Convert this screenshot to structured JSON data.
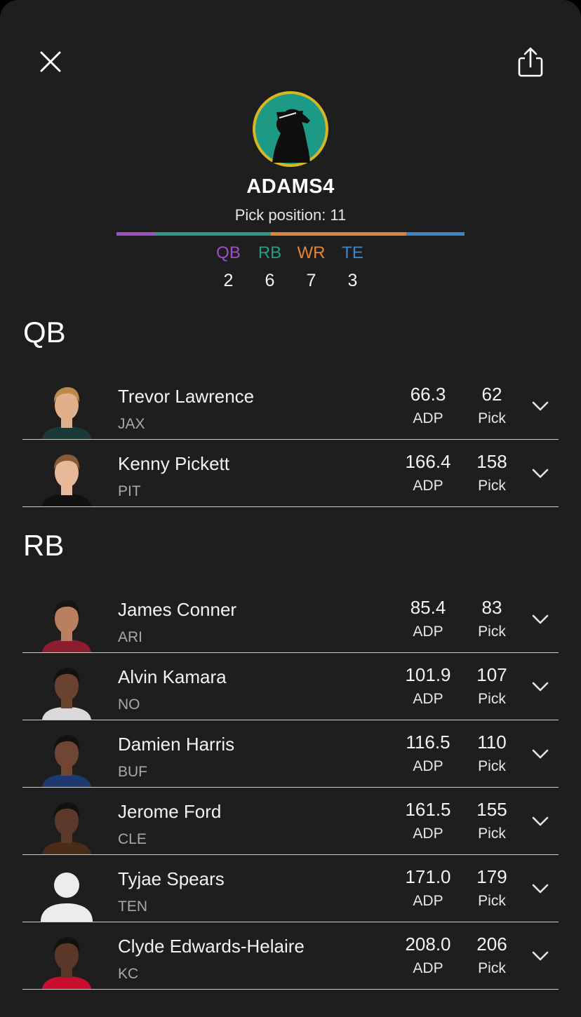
{
  "header": {
    "username": "ADAMS4",
    "pick_position": "Pick position: 11",
    "avatar_colors": {
      "ring": "#d8b523",
      "fill": "#1c9a86",
      "figure": "#0e0e0e"
    }
  },
  "position_counts": [
    {
      "label": "QB",
      "count": "2",
      "color": "#9f4fc4"
    },
    {
      "label": "RB",
      "count": "6",
      "color": "#2a9a85"
    },
    {
      "label": "WR",
      "count": "7",
      "color": "#e0863a"
    },
    {
      "label": "TE",
      "count": "3",
      "color": "#3a86c6"
    }
  ],
  "sections": [
    {
      "title": "QB",
      "players": [
        {
          "name": "Trevor Lawrence",
          "team": "JAX",
          "adp": "66.3",
          "pick": "62",
          "adp_label": "ADP",
          "pick_label": "Pick",
          "photo": "headshot",
          "skin": "#e0b08a",
          "hair": "#b98a4a",
          "jersey": "#1a3a3a"
        },
        {
          "name": "Kenny Pickett",
          "team": "PIT",
          "adp": "166.4",
          "pick": "158",
          "adp_label": "ADP",
          "pick_label": "Pick",
          "photo": "headshot",
          "skin": "#e7b899",
          "hair": "#8a5a34",
          "jersey": "#111111"
        }
      ]
    },
    {
      "title": "RB",
      "players": [
        {
          "name": "James Conner",
          "team": "ARI",
          "adp": "85.4",
          "pick": "83",
          "adp_label": "ADP",
          "pick_label": "Pick",
          "photo": "headshot",
          "skin": "#b88061",
          "hair": "#1a1410",
          "jersey": "#8e1c2f"
        },
        {
          "name": "Alvin Kamara",
          "team": "NO",
          "adp": "101.9",
          "pick": "107",
          "adp_label": "ADP",
          "pick_label": "Pick",
          "photo": "headshot",
          "skin": "#6a4330",
          "hair": "#15100c",
          "jersey": "#d9d9d9"
        },
        {
          "name": "Damien Harris",
          "team": "BUF",
          "adp": "116.5",
          "pick": "110",
          "adp_label": "ADP",
          "pick_label": "Pick",
          "photo": "headshot",
          "skin": "#6e4633",
          "hair": "#15100c",
          "jersey": "#1d3a6e"
        },
        {
          "name": "Jerome Ford",
          "team": "CLE",
          "adp": "161.5",
          "pick": "155",
          "adp_label": "ADP",
          "pick_label": "Pick",
          "photo": "headshot",
          "skin": "#5c3a29",
          "hair": "#15100c",
          "jersey": "#4a2b17"
        },
        {
          "name": "Tyjae Spears",
          "team": "TEN",
          "adp": "171.0",
          "pick": "179",
          "adp_label": "ADP",
          "pick_label": "Pick",
          "photo": "placeholder",
          "skin": "#ececec",
          "hair": "#ececec",
          "jersey": "#ececec"
        },
        {
          "name": "Clyde Edwards-Helaire",
          "team": "KC",
          "adp": "208.0",
          "pick": "206",
          "adp_label": "ADP",
          "pick_label": "Pick",
          "photo": "headshot",
          "skin": "#5a3827",
          "hair": "#15100c",
          "jersey": "#c8102e"
        }
      ]
    }
  ]
}
